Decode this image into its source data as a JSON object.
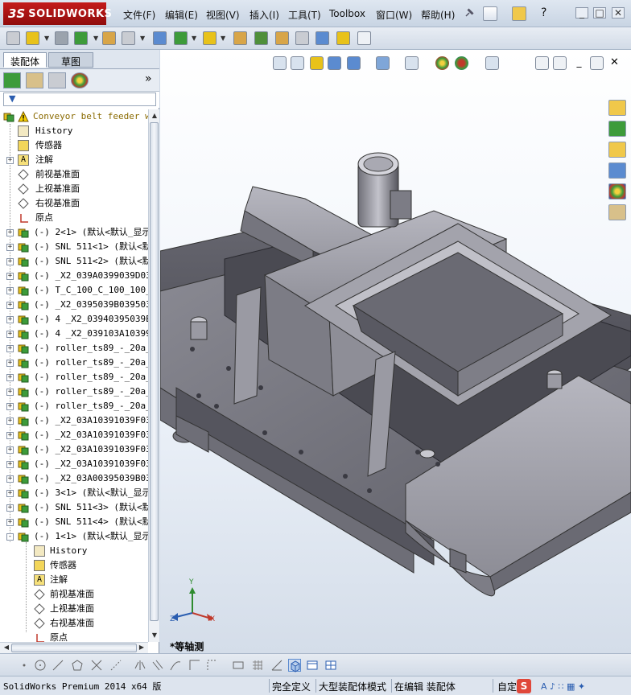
{
  "app": {
    "brand_prefix": "3S",
    "brand_name": "SOLIDWORKS"
  },
  "menu": [
    "文件(F)",
    "编辑(E)",
    "视图(V)",
    "插入(I)",
    "工具(T)",
    "Toolbox",
    "窗口(W)",
    "帮助(H)"
  ],
  "panel": {
    "tab_assembly": "装配体",
    "tab_sketch": "草图"
  },
  "tree": {
    "root": "Conveyor belt feeder wit",
    "root_items": [
      "History",
      "传感器",
      "注解",
      "前视基准面",
      "上视基准面",
      "右视基准面",
      "原点"
    ],
    "components": [
      "(-) 2<1> (默认<默认_显示",
      "(-) SNL 511<1> (默认<默",
      "(-) SNL 511<2> (默认<默",
      "(-) _X2_039A0399039D039",
      "(-) T_C_100_C_100_100_B",
      "(-) _X2_0395039B039503A",
      "(-) 4 _X2_03940395039E0",
      "(-) 4 _X2_039103A103990",
      "(-) roller_ts89_-_20a_-",
      "(-) roller_ts89_-_20a_-",
      "(-) roller_ts89_-_20a_-",
      "(-) roller_ts89_-_20a_-",
      "(-) roller_ts89_-_20a_-",
      "(-) _X2_03A10391039F03A",
      "(-) _X2_03A10391039F03A",
      "(-) _X2_03A10391039F03A",
      "(-) _X2_03A10391039F03A",
      "(-) _X2_03A00395039B039",
      "(-) 3<1> (默认<默认_显示",
      "(-) SNL 511<3> (默认<默",
      "(-) SNL 511<4> (默认<默",
      "(-) 1<1> (默认<默认_显示"
    ],
    "sub_items": [
      "History",
      "传感器",
      "注解",
      "前视基准面",
      "上视基准面",
      "右视基准面",
      "原点"
    ]
  },
  "graphics": {
    "view_label": "*等轴测",
    "triad": {
      "x": "X",
      "y": "Y",
      "z": "Z"
    }
  },
  "status": {
    "product": "SolidWorks Premium 2014 x64 版",
    "fully_defined": "完全定义",
    "large_assembly": "大型装配体模式",
    "editing": "在编辑 装配体",
    "custom": "自定"
  },
  "colors": {
    "brand_red": "#b31616",
    "viewport_top": "#ffffff",
    "viewport_bottom": "#d4dde9",
    "model_gray": "#8c8c95",
    "part_yellow": "#e8c21a",
    "part_green": "#3d9b3a"
  },
  "icons": {
    "filter": "filter-icon",
    "warning": "warning-icon",
    "assembly": "assembly-icon",
    "plane": "plane-icon",
    "origin": "origin-icon"
  }
}
